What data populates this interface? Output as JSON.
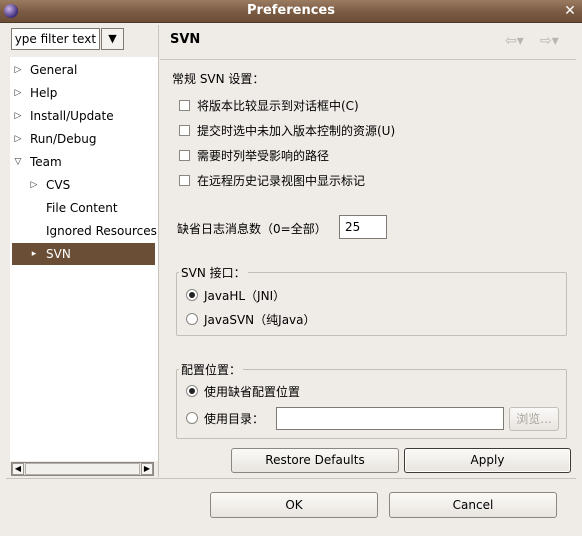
{
  "window": {
    "title": "Preferences",
    "close_glyph": "✕"
  },
  "left": {
    "filter_placeholder": "type filter text",
    "tree": [
      {
        "label": "General",
        "expander": "collapsed"
      },
      {
        "label": "Help",
        "expander": "collapsed"
      },
      {
        "label": "Install/Update",
        "expander": "collapsed"
      },
      {
        "label": "Run/Debug",
        "expander": "collapsed"
      },
      {
        "label": "Team",
        "expander": "expanded"
      },
      {
        "label": "CVS",
        "expander": "collapsed"
      },
      {
        "label": "File Content",
        "expander": "none"
      },
      {
        "label": "Ignored Resources",
        "expander": "none"
      },
      {
        "label": "SVN",
        "expander": "collapsed",
        "selected": true
      }
    ]
  },
  "page": {
    "title": "SVN",
    "general_heading": "常规 SVN 设置：",
    "checkboxes": [
      {
        "label": "将版本比较显示到对话框中(C)",
        "checked": false
      },
      {
        "label": "提交时选中未加入版本控制的资源(U)",
        "checked": false
      },
      {
        "label": "需要时列举受影响的路径",
        "checked": false
      },
      {
        "label": "在远程历史记录视图中显示标记",
        "checked": false
      }
    ],
    "log_count_label": "缺省日志消息数（0=全部）",
    "log_count_value": "25",
    "svn_interface": {
      "title": "SVN 接口：",
      "options": [
        {
          "label": "JavaHL（JNI）",
          "selected": true
        },
        {
          "label": "JavaSVN（纯Java）",
          "selected": false
        }
      ]
    },
    "config_location": {
      "title": "配置位置：",
      "default_label": "使用缺省配置位置",
      "directory_label": "使用目录：",
      "directory_value": "",
      "browse_label": "浏览..."
    },
    "restore_defaults_label": "Restore Defaults",
    "apply_label": "Apply"
  },
  "footer": {
    "ok_label": "OK",
    "cancel_label": "Cancel"
  },
  "icons": {
    "back": "left-arrow-icon",
    "forward": "right-arrow-icon",
    "expander": "triangle-icon",
    "app": "eclipse-icon"
  },
  "colors": {
    "selection": "#6a4e36",
    "titlebar": "#7a5a42",
    "background": "#efebe7"
  }
}
